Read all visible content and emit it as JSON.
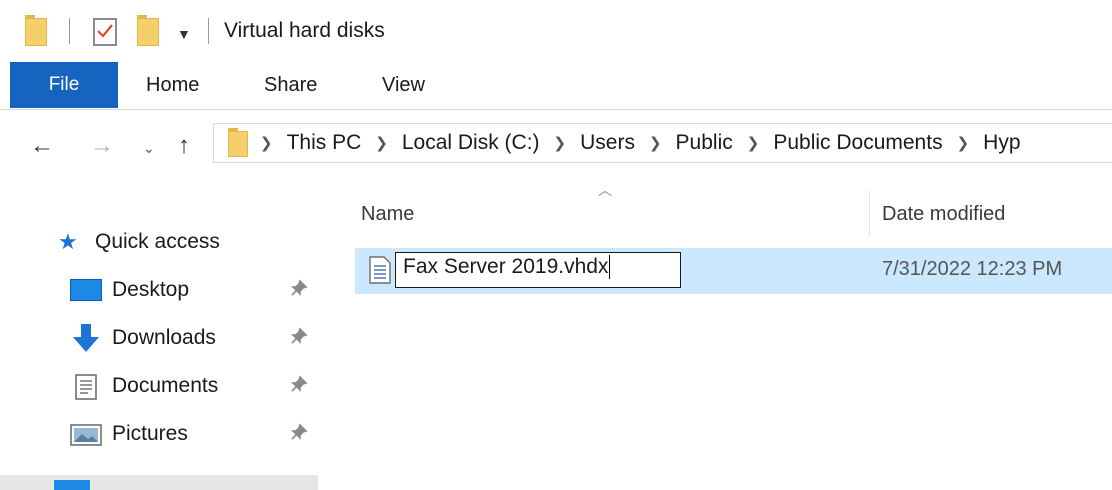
{
  "window": {
    "title": "Virtual hard disks"
  },
  "ribbon": {
    "tabs": [
      "File",
      "Home",
      "Share",
      "View"
    ]
  },
  "address": {
    "crumbs": [
      "This PC",
      "Local Disk (C:)",
      "Users",
      "Public",
      "Public Documents",
      "Hyp"
    ]
  },
  "navpane": {
    "quick_access": "Quick access",
    "items": [
      {
        "label": "Desktop",
        "icon": "desktop-icon"
      },
      {
        "label": "Downloads",
        "icon": "downloads-icon"
      },
      {
        "label": "Documents",
        "icon": "documents-icon"
      },
      {
        "label": "Pictures",
        "icon": "pictures-icon"
      }
    ],
    "pin_glyph": "📌"
  },
  "columns": {
    "name": "Name",
    "date": "Date modified"
  },
  "file": {
    "name": "Fax Server 2019.vhdx",
    "date": "7/31/2022 12:23 PM"
  },
  "colors": {
    "file_tab": "#1565c0",
    "selection": "#cce8ff",
    "folder": "#f5cf6a"
  }
}
